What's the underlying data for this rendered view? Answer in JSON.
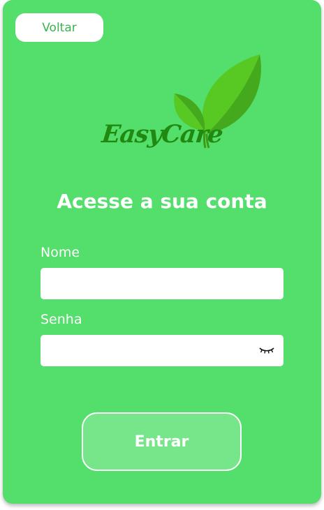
{
  "header": {
    "back_label": "Voltar"
  },
  "logo": {
    "text": "EasyCare",
    "icon": "leaf-icon"
  },
  "form": {
    "title": "Acesse a sua conta",
    "name_label": "Nome",
    "name_value": "",
    "password_label": "Senha",
    "password_value": "",
    "password_toggle_icon": "eye-closed-icon",
    "submit_label": "Entrar"
  },
  "colors": {
    "background": "#54de6b",
    "button": "#77e68a",
    "back_text": "#39b44f",
    "logo_text": "#1f8a0f"
  }
}
